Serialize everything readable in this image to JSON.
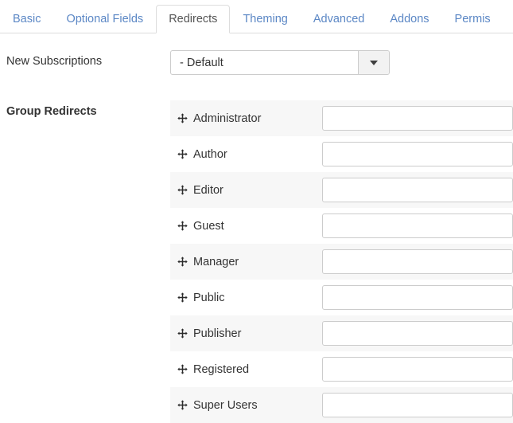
{
  "tabs": {
    "items": [
      {
        "label": "Basic",
        "active": false
      },
      {
        "label": "Optional Fields",
        "active": false
      },
      {
        "label": "Redirects",
        "active": true
      },
      {
        "label": "Theming",
        "active": false
      },
      {
        "label": "Advanced",
        "active": false
      },
      {
        "label": "Addons",
        "active": false
      },
      {
        "label": "Permis",
        "active": false
      }
    ]
  },
  "form": {
    "new_subscriptions": {
      "label": "New Subscriptions",
      "selected": "- Default",
      "caret_icon": "chevron-down-icon"
    },
    "group_redirects": {
      "label": "Group Redirects",
      "drag_icon": "move-arrows-icon",
      "rows": [
        {
          "name": "Administrator",
          "value": "",
          "placeholder": ""
        },
        {
          "name": "Author",
          "value": "",
          "placeholder": ""
        },
        {
          "name": "Editor",
          "value": "",
          "placeholder": ""
        },
        {
          "name": "Guest",
          "value": "",
          "placeholder": ""
        },
        {
          "name": "Manager",
          "value": "",
          "placeholder": ""
        },
        {
          "name": "Public",
          "value": "",
          "placeholder": ""
        },
        {
          "name": "Publisher",
          "value": "",
          "placeholder": ""
        },
        {
          "name": "Registered",
          "value": "",
          "placeholder": ""
        },
        {
          "name": "Super Users",
          "value": "",
          "placeholder": ""
        }
      ]
    }
  },
  "colors": {
    "tab_link": "#5b87c5",
    "tab_active_text": "#555555",
    "border": "#dddddd",
    "input_border": "#cccccc",
    "stripe": "#f7f7f7",
    "text": "#333333"
  }
}
